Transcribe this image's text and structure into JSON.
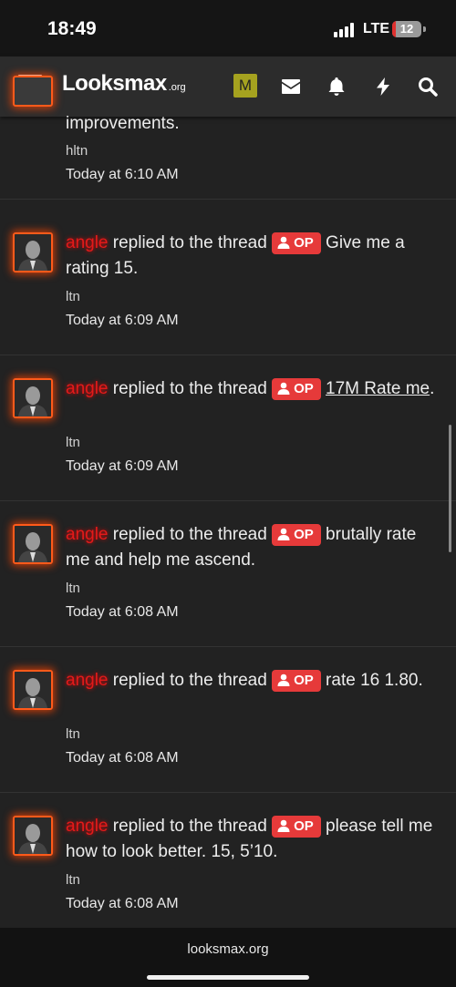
{
  "status": {
    "time": "18:49",
    "network": "LTE",
    "battery": "12",
    "battery_fraction": 0.12,
    "battery_color": "#e0312f"
  },
  "nav": {
    "logo_main": "Looksmax",
    "logo_tld": ".org",
    "avatar_letter": "M",
    "avatar_color": "#a5a21f",
    "icons": [
      "menu-icon",
      "envelope-icon",
      "bell-icon",
      "bolt-icon",
      "search-icon"
    ]
  },
  "alerts": [
    {
      "user": "",
      "action": "",
      "op": "",
      "thread": "improvements.",
      "forum": "hltn",
      "time": "Today at 6:10 AM",
      "partial": true
    },
    {
      "user": "angle",
      "action": " replied to the thread ",
      "op": "OP",
      "thread": "Give me a rating 15.",
      "forum": "ltn",
      "time": "Today at 6:09 AM"
    },
    {
      "user": "angle",
      "action": " replied to the thread ",
      "op": "OP",
      "thread": "17M Rate me",
      "thread_suffix": ".",
      "underline": true,
      "forum": "ltn",
      "time": "Today at 6:09 AM"
    },
    {
      "user": "angle",
      "action": " replied to the thread ",
      "op": "OP",
      "thread": "brutally rate me and help me ascend.",
      "forum": "ltn",
      "time": "Today at 6:08 AM"
    },
    {
      "user": "angle",
      "action": " replied to the thread ",
      "op": "OP",
      "thread": "rate 16 1.80.",
      "forum": "ltn",
      "time": "Today at 6:08 AM"
    },
    {
      "user": "angle",
      "action": " replied to the thread ",
      "op": "OP",
      "thread": "please tell me how to look better. 15, 5’10.",
      "forum": "ltn",
      "time": "Today at 6:08 AM"
    }
  ],
  "footer": {
    "url": "looksmax.org"
  }
}
